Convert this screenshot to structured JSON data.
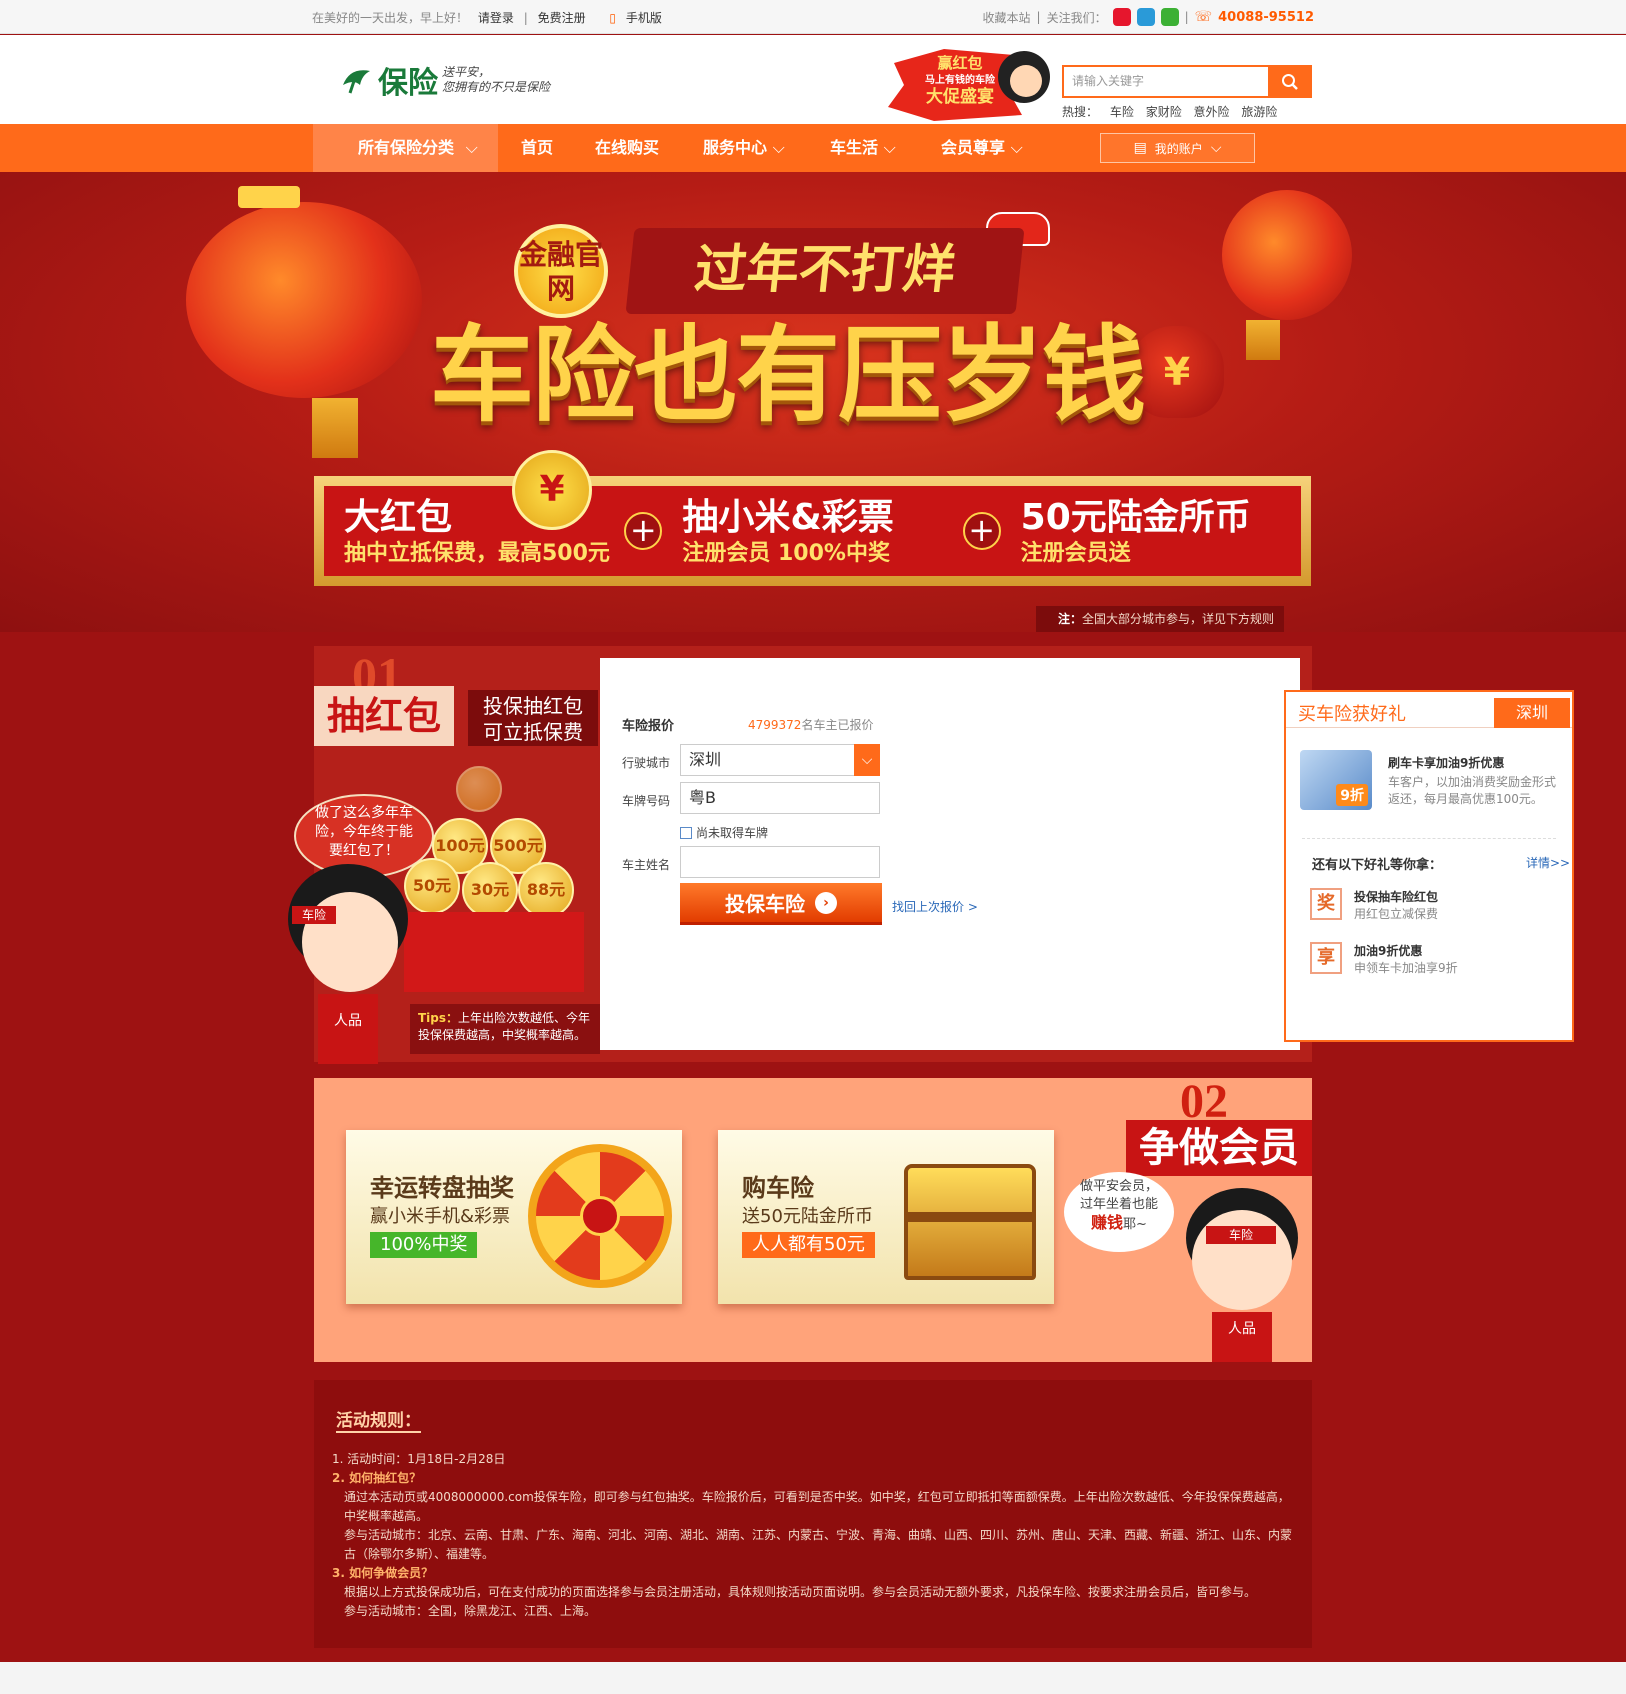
{
  "topbar": {
    "greeting": "在美好的一天出发，早上好！",
    "login": "请登录",
    "register": "免费注册",
    "mobile": "手机版",
    "favorite": "收藏本站",
    "follow": "关注我们：",
    "phone": "40088-95512"
  },
  "header": {
    "logo_name": "保险",
    "logo_slogan_1": "送平安，",
    "logo_slogan_2": "您拥有的不只是保险",
    "promo_1": "赢红包",
    "promo_2": "马上有钱的车险",
    "promo_3": "大促盛宴",
    "search_placeholder": "请输入关键字",
    "hot_label": "热搜：",
    "hot_items": [
      "车险",
      "家财险",
      "意外险",
      "旅游险"
    ]
  },
  "nav": {
    "category": "所有保险分类",
    "items": [
      "首页",
      "在线购买",
      "服务中心",
      "车生活",
      "会员尊享"
    ],
    "account": "我的账户"
  },
  "banner": {
    "tag": "金融官网",
    "subtitle": "过年不打烊",
    "title": "车险也有压岁钱",
    "offers": [
      {
        "title": "大红包",
        "desc": "抽中立抵保费，最高500元"
      },
      {
        "title": "抽小米&彩票",
        "desc": "注册会员  100%中奖"
      },
      {
        "title": "50元陆金所币",
        "desc": "注册会员送"
      }
    ],
    "note_label": "注：",
    "note": "全国大部分城市参与，详见下方规则"
  },
  "section1": {
    "num": "01",
    "title": "抽红包",
    "subtitle_1": "投保抽红包",
    "subtitle_2": "可立抵保费",
    "bubble_1": "做了这么多年车",
    "bubble_2": "险，今年终于能",
    "bubble_3": "要红包了！",
    "coins": [
      "100元",
      "500元",
      "50元",
      "30元",
      "88元"
    ],
    "char_tag": "车险",
    "char_badge": "人品",
    "tips_label": "Tips：",
    "tips": "上年出险次数越低、今年投保保费越高，中奖概率越高。"
  },
  "quote": {
    "title": "车险报价",
    "count": "4799372",
    "count_suffix": "名车主已报价",
    "city_label": "行驶城市",
    "city_value": "深圳",
    "plate_label": "车牌号码",
    "plate_value": "粤B",
    "no_plate": "尚未取得车牌",
    "owner_label": "车主姓名",
    "owner_value": "",
    "submit": "投保车险",
    "prev": "找回上次报价 >"
  },
  "gift": {
    "title": "买车险获好礼",
    "city": "深圳",
    "card_text": "9折",
    "card_title": "刷车卡享加油9折优惠",
    "card_desc": "车客户，以加油消费奖励金形式返还，每月最高优惠100元。",
    "more_title": "还有以下好礼等你拿：",
    "detail": "详情>>",
    "perks": [
      {
        "icon": "奖",
        "title": "投保抽车险红包",
        "desc": "用红包立减保费"
      },
      {
        "icon": "享",
        "title": "加油9折优惠",
        "desc": "申领车卡加油享9折"
      }
    ]
  },
  "section2": {
    "num": "02",
    "title": "争做会员",
    "card1_title": "幸运转盘抽奖",
    "card1_sub": "赢小米手机&彩票",
    "card1_badge": "100%中奖",
    "card2_title": "购车险",
    "card2_sub": "送50元陆金所币",
    "card2_badge": "人人都有50元",
    "bubble_1": "做平安会员，",
    "bubble_2": "过年坐着也能",
    "bubble_3": "赚钱",
    "bubble_4": "耶~",
    "char_tag": "车险",
    "char_badge": "人品",
    "colors": {
      "green": "#46b62a",
      "orange": "#ff6a1a"
    }
  },
  "rules": {
    "title": "活动规则：",
    "lines": [
      {
        "text": "1. 活动时间：1月18日-2月28日",
        "type": "normal"
      },
      {
        "text": "2. 如何抽红包？",
        "type": "head"
      },
      {
        "text": "通过本活动页或4008000000.com投保车险，即可参与红包抽奖。车险报价后，可看到是否中奖。如中奖，红包可立即抵扣等面额保费。上年出险次数越低、今年投保保费越高，中奖概率越高。",
        "type": "sub"
      },
      {
        "text": "参与活动城市：北京、云南、甘肃、广东、海南、河北、河南、湖北、湖南、江苏、内蒙古、宁波、青海、曲靖、山西、四川、苏州、唐山、天津、西藏、新疆、浙江、山东、内蒙古（除鄂尔多斯）、福建等。",
        "type": "sub"
      },
      {
        "text": "3. 如何争做会员？",
        "type": "head"
      },
      {
        "text": "根据以上方式投保成功后，可在支付成功的页面选择参与会员注册活动，具体规则按活动页面说明。参与会员活动无额外要求，凡投保车险、按要求注册会员后，皆可参与。",
        "type": "sub"
      },
      {
        "text": "参与活动城市：全国，除黑龙江、江西、上海。",
        "type": "sub"
      }
    ]
  }
}
